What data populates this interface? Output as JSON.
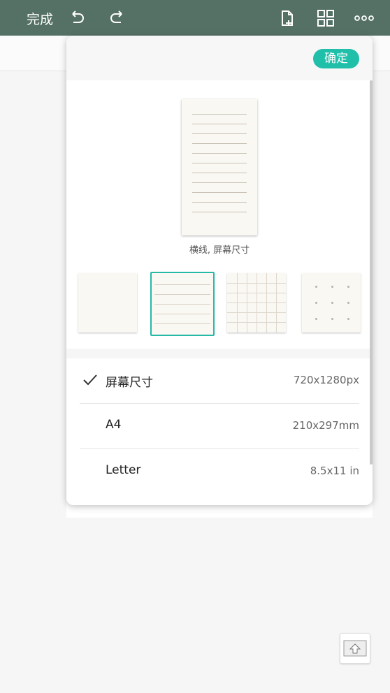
{
  "toolbar": {
    "done_label": "完成",
    "icons": [
      "undo-icon",
      "redo-icon",
      "add-page-icon",
      "grid-view-icon",
      "more-icon"
    ]
  },
  "popup": {
    "confirm_label": "确定",
    "preview_caption": "横线, 屏幕尺寸",
    "templates": [
      {
        "name": "blank",
        "selected": false
      },
      {
        "name": "lined",
        "selected": true
      },
      {
        "name": "grid",
        "selected": false
      },
      {
        "name": "dotted",
        "selected": false
      }
    ],
    "sizes": [
      {
        "name": "屏幕尺寸",
        "dimension": "720x1280px",
        "selected": true
      },
      {
        "name": "A4",
        "dimension": "210x297mm",
        "selected": false
      },
      {
        "name": "Letter",
        "dimension": "8.5x11 in",
        "selected": false
      }
    ]
  },
  "colors": {
    "toolbar": "#557166",
    "accent": "#1fbfaa",
    "paper": "#faf8f3"
  }
}
